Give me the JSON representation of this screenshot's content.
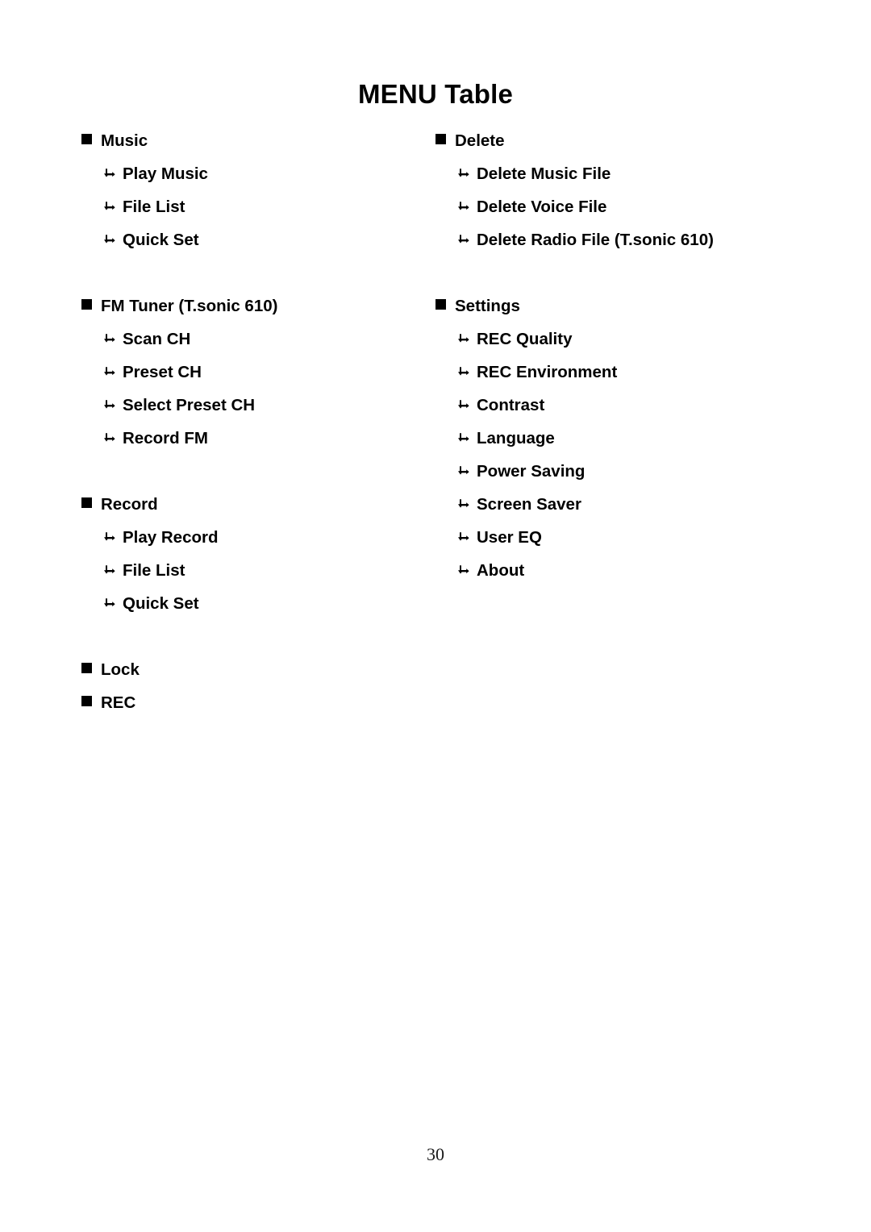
{
  "document": {
    "title": "MENU Table",
    "page_number": "30"
  },
  "icons": {
    "main_bullet": "filled-square-bullet",
    "sub_bullet": "sub-item-arrow"
  },
  "columns": {
    "left": [
      {
        "title": "Music",
        "items": [
          "Play Music",
          "File List",
          "Quick Set"
        ]
      },
      {
        "title": "FM Tuner (T.sonic 610)",
        "items": [
          "Scan CH",
          "Preset CH",
          "Select Preset CH",
          "Record FM"
        ]
      },
      {
        "title": "Record",
        "items": [
          "Play Record",
          "File List",
          "Quick Set"
        ]
      },
      {
        "title": "Lock",
        "items": []
      },
      {
        "title": "REC",
        "items": []
      }
    ],
    "right": [
      {
        "title": "Delete",
        "items": [
          "Delete Music File",
          "Delete Voice File",
          "Delete Radio File (T.sonic 610)"
        ]
      },
      {
        "title": "Settings",
        "items": [
          "REC Quality",
          "REC Environment",
          "Contrast",
          "Language",
          "Power Saving",
          "Screen Saver",
          "User EQ",
          "About"
        ]
      }
    ]
  }
}
